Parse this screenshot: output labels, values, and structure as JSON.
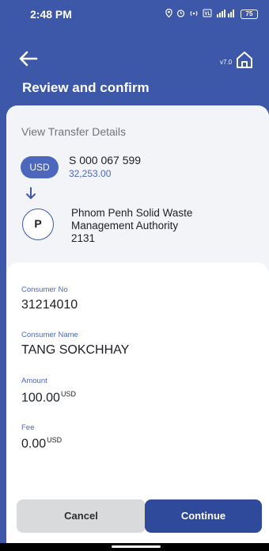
{
  "status_bar": {
    "time": "2:48 PM",
    "battery": "75"
  },
  "header": {
    "version": "v7.0",
    "title": "Review and confirm"
  },
  "transfer": {
    "section_label": "View Transfer Details",
    "from": {
      "currency": "USD",
      "account_number": "S 000 067 599",
      "balance": "32,253.00"
    },
    "to": {
      "initial": "P",
      "name_line1": "Phnom Penh Solid Waste",
      "name_line2": "Management Authority",
      "name_line3": "2131"
    }
  },
  "details": {
    "consumer_no": {
      "label": "Consumer No",
      "value": "31214010"
    },
    "consumer_name": {
      "label": "Consumer Name",
      "value": "TANG SOKCHHAY"
    },
    "amount": {
      "label": "Amount",
      "value": "100.00",
      "unit": "USD"
    },
    "fee": {
      "label": "Fee",
      "value": "0.00",
      "unit": "USD"
    }
  },
  "actions": {
    "cancel_label": "Cancel",
    "continue_label": "Continue"
  },
  "colors": {
    "brand": "#3d58a8",
    "accent": "#4d67bd",
    "primary_button": "#2f4a9a",
    "secondary_button": "#d9dadc"
  }
}
